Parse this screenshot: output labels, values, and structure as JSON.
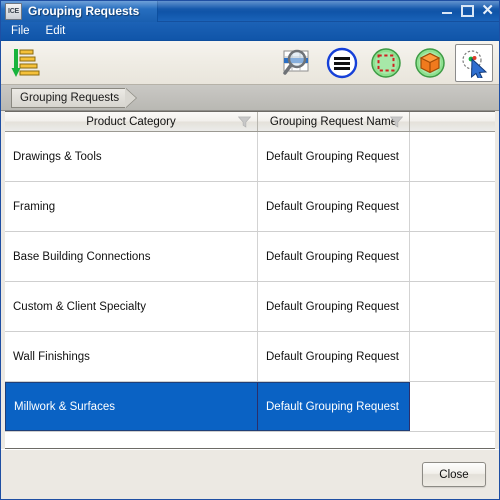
{
  "window": {
    "app_icon_label": "ICE",
    "title": "Grouping Requests",
    "controls": {
      "minimize": "minimize-button",
      "maximize": "maximize-button",
      "close": "close-button",
      "close_glyph": "✕"
    }
  },
  "menubar": {
    "items": [
      {
        "label": "File"
      },
      {
        "label": "Edit"
      }
    ]
  },
  "toolbar": {
    "left_buttons": [
      {
        "name": "sort-descending-icon",
        "tooltip": "Sort"
      }
    ],
    "right_buttons": [
      {
        "name": "find-in-table-icon",
        "tooltip": "Find"
      },
      {
        "name": "list-menu-icon",
        "tooltip": "List"
      },
      {
        "name": "select-region-icon",
        "tooltip": "Select Region"
      },
      {
        "name": "model-object-icon",
        "tooltip": "Object"
      },
      {
        "name": "pointer-select-icon",
        "tooltip": "Select",
        "pressed": true
      }
    ]
  },
  "breadcrumb": {
    "items": [
      {
        "label": "Grouping Requests"
      }
    ]
  },
  "table": {
    "columns": [
      {
        "label": "Product Category",
        "filter": true
      },
      {
        "label": "Grouping Request Name",
        "filter": true
      },
      {
        "label": "",
        "filter": false
      }
    ],
    "rows": [
      {
        "product_category": "Drawings & Tools",
        "grouping_request_name": "Default Grouping Request",
        "selected": false
      },
      {
        "product_category": "Framing",
        "grouping_request_name": "Default Grouping Request",
        "selected": false
      },
      {
        "product_category": "Base Building Connections",
        "grouping_request_name": "Default Grouping Request",
        "selected": false
      },
      {
        "product_category": "Custom & Client Specialty",
        "grouping_request_name": "Default Grouping Request",
        "selected": false
      },
      {
        "product_category": "Wall Finishings",
        "grouping_request_name": "Default Grouping Request",
        "selected": false
      },
      {
        "product_category": "Millwork & Surfaces",
        "grouping_request_name": "Default Grouping Request",
        "selected": true
      }
    ]
  },
  "footer": {
    "close_label": "Close"
  },
  "colors": {
    "titlebar_blue": "#1457aa",
    "selection_blue": "#0a62c4",
    "toolbar_bg": "#efece4",
    "dialog_bg": "#ece9e3"
  }
}
